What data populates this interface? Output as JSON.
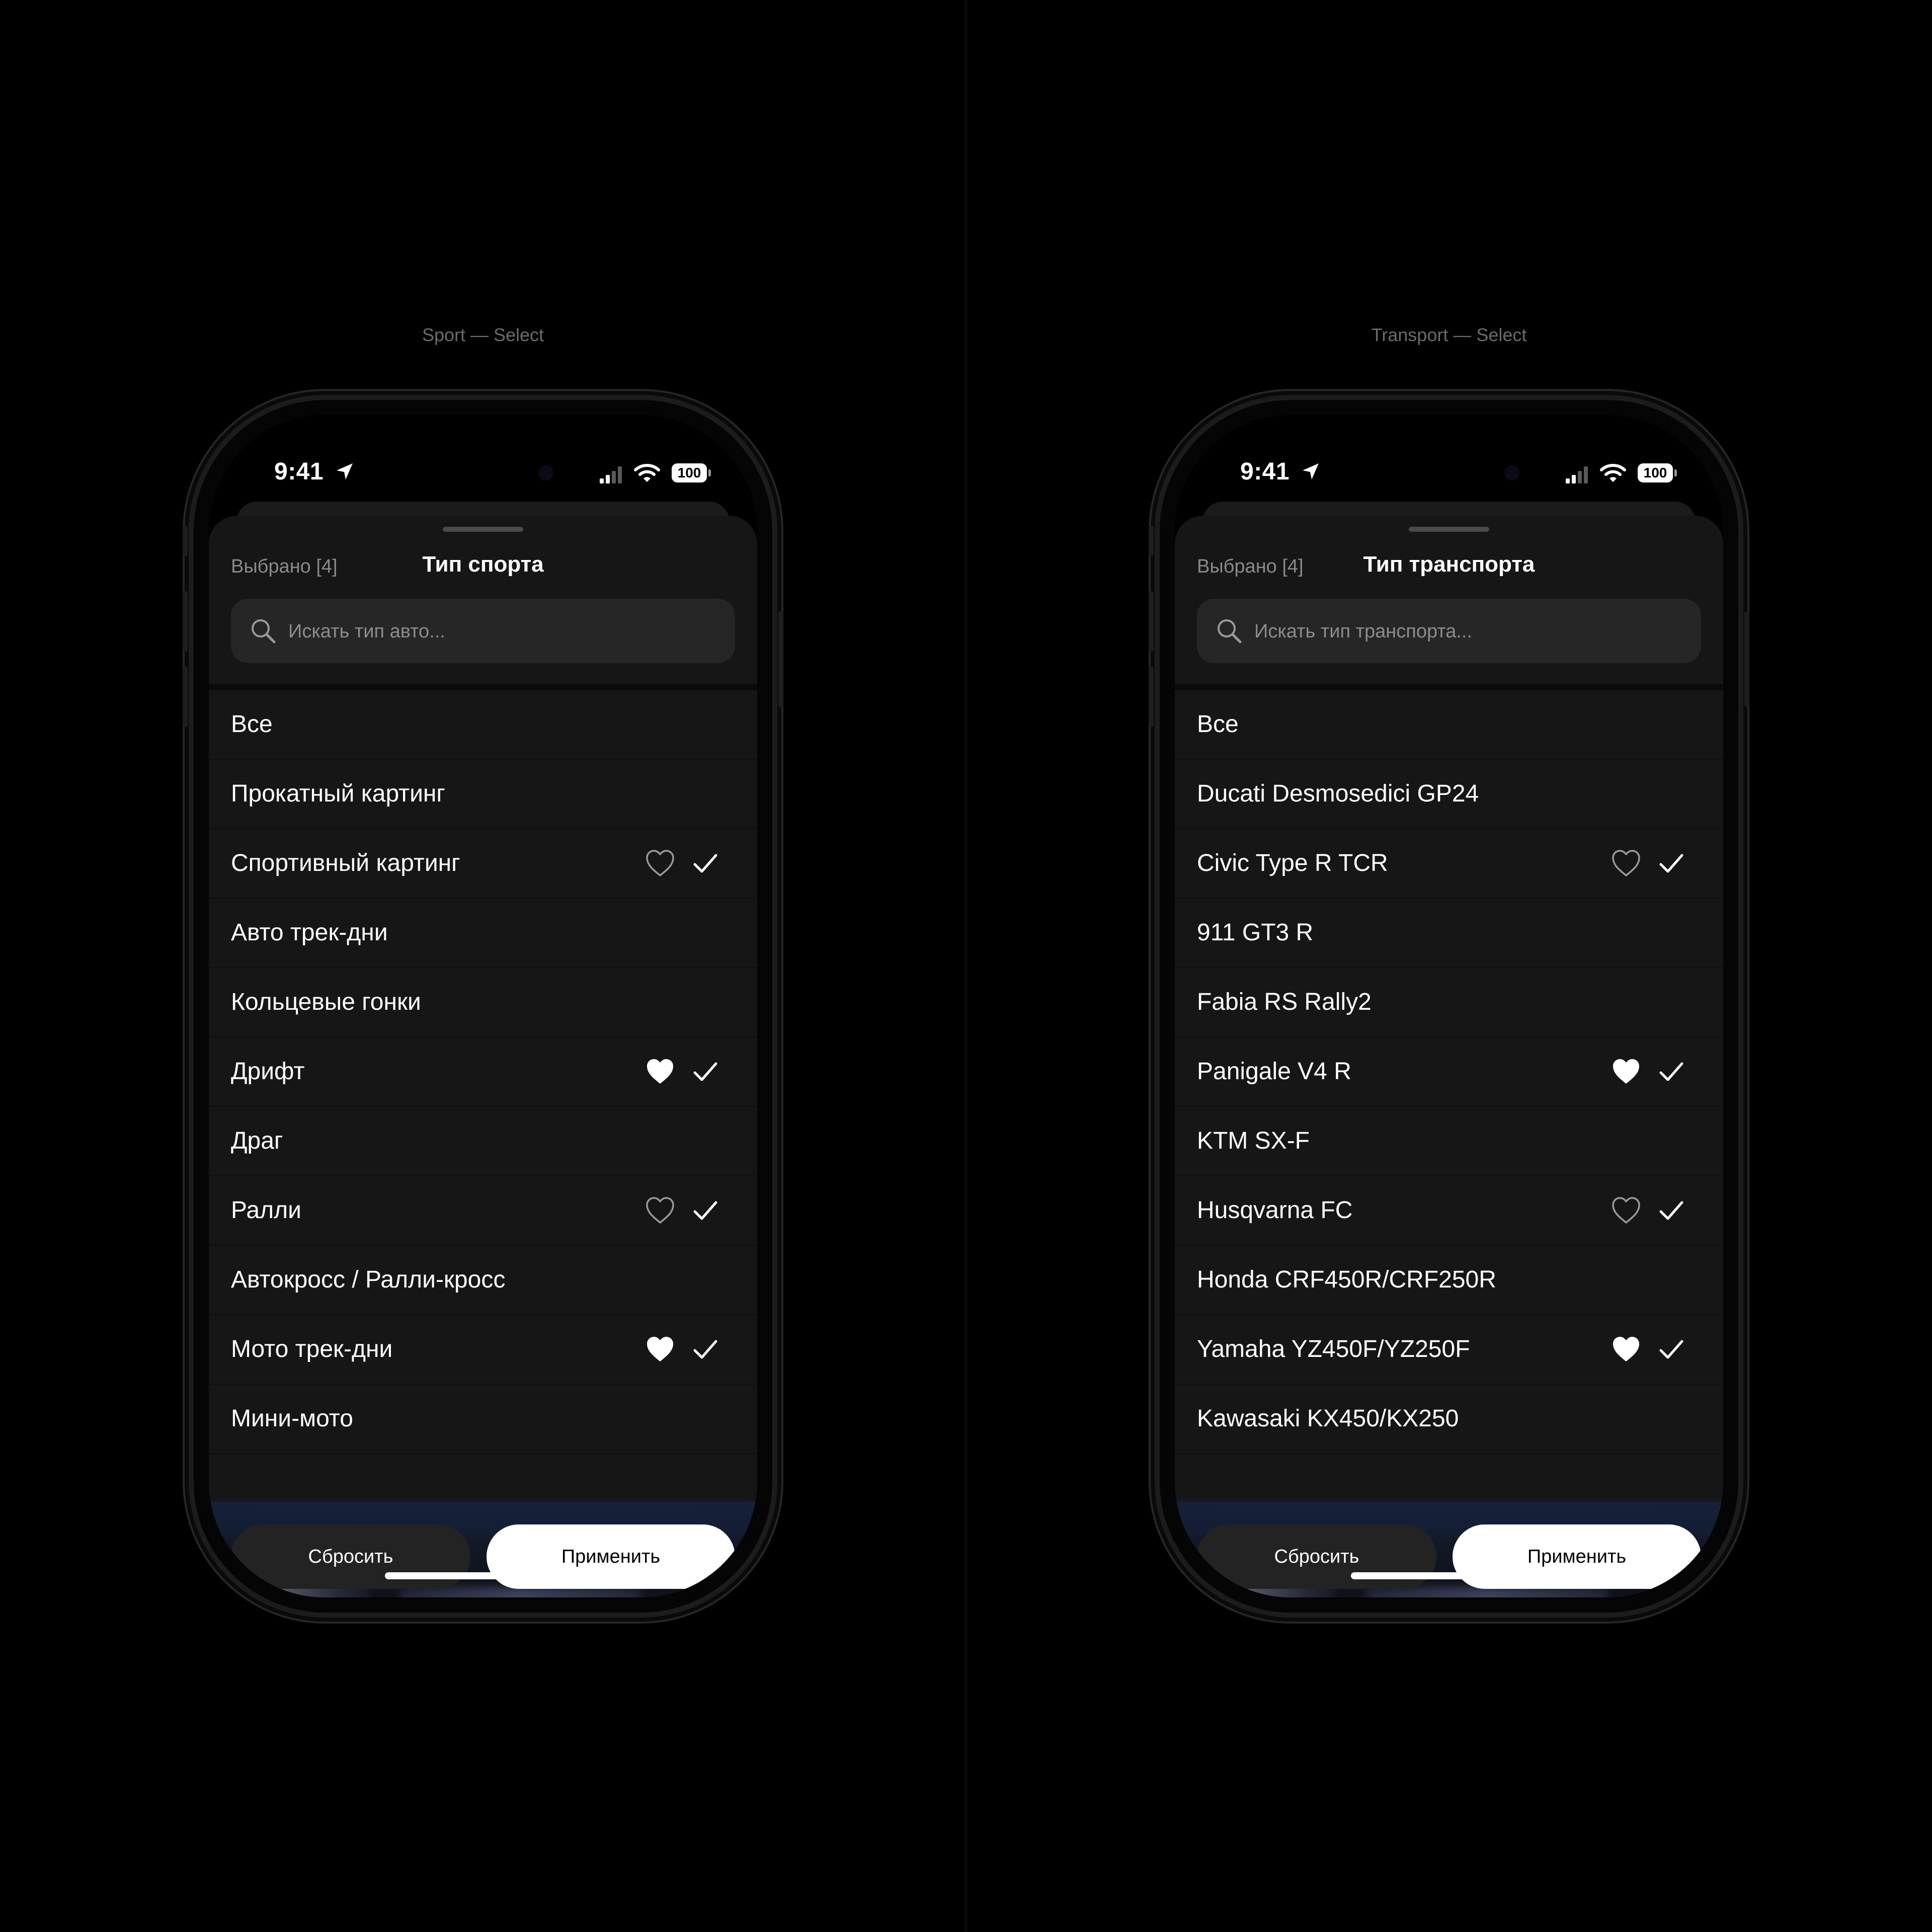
{
  "screens": [
    {
      "frame_label": "Sport — Select",
      "status": {
        "time": "9:41",
        "battery": "100"
      },
      "selected_count": "Выбрано [4]",
      "title": "Тип спорта",
      "search_placeholder": "Искать тип авто...",
      "items": [
        {
          "label": "Все",
          "favorite": null,
          "checked": false
        },
        {
          "label": "Прокатный картинг",
          "favorite": null,
          "checked": false
        },
        {
          "label": "Спортивный картинг",
          "favorite": "outline",
          "checked": true
        },
        {
          "label": "Авто трек-дни",
          "favorite": null,
          "checked": false
        },
        {
          "label": "Кольцевые гонки",
          "favorite": null,
          "checked": false
        },
        {
          "label": "Дрифт",
          "favorite": "filled",
          "checked": true
        },
        {
          "label": "Драг",
          "favorite": null,
          "checked": false
        },
        {
          "label": "Ралли",
          "favorite": "outline",
          "checked": true
        },
        {
          "label": "Автокросс / Ралли-кросс",
          "favorite": null,
          "checked": false
        },
        {
          "label": "Мото трек-дни",
          "favorite": "filled",
          "checked": true
        },
        {
          "label": "Мини-мото",
          "favorite": null,
          "checked": false
        }
      ],
      "reset_label": "Сбросить",
      "apply_label": "Применить"
    },
    {
      "frame_label": "Transport — Select",
      "status": {
        "time": "9:41",
        "battery": "100"
      },
      "selected_count": "Выбрано [4]",
      "title": "Тип транспорта",
      "search_placeholder": "Искать тип транспорта...",
      "items": [
        {
          "label": "Все",
          "favorite": null,
          "checked": false
        },
        {
          "label": "Ducati Desmosedici GP24",
          "favorite": null,
          "checked": false
        },
        {
          "label": "Civic Type R TCR",
          "favorite": "outline",
          "checked": true
        },
        {
          "label": "911 GT3 R",
          "favorite": null,
          "checked": false
        },
        {
          "label": "Fabia RS Rally2",
          "favorite": null,
          "checked": false
        },
        {
          "label": "Panigale V4 R",
          "favorite": "filled",
          "checked": true
        },
        {
          "label": "KTM SX-F",
          "favorite": null,
          "checked": false
        },
        {
          "label": "Husqvarna FC",
          "favorite": "outline",
          "checked": true
        },
        {
          "label": "Honda CRF450R/CRF250R",
          "favorite": null,
          "checked": false
        },
        {
          "label": "Yamaha YZ450F/YZ250F",
          "favorite": "filled",
          "checked": true
        },
        {
          "label": "Kawasaki KX450/KX250",
          "favorite": null,
          "checked": false
        }
      ],
      "reset_label": "Сбросить",
      "apply_label": "Применить"
    }
  ],
  "icons": {
    "search": "search-icon",
    "heart_outline": "heart-outline-icon",
    "heart_filled": "heart-filled-icon",
    "check": "checkmark-icon",
    "location": "location-arrow-icon",
    "signal": "cellular-signal-icon",
    "wifi": "wifi-icon",
    "battery": "battery-icon"
  },
  "colors": {
    "background": "#000000",
    "sheet": "#161616",
    "search_bg": "#262626",
    "secondary_text": "#8a8a8a",
    "apply_bg": "#ffffff",
    "reset_bg": "#232323"
  }
}
